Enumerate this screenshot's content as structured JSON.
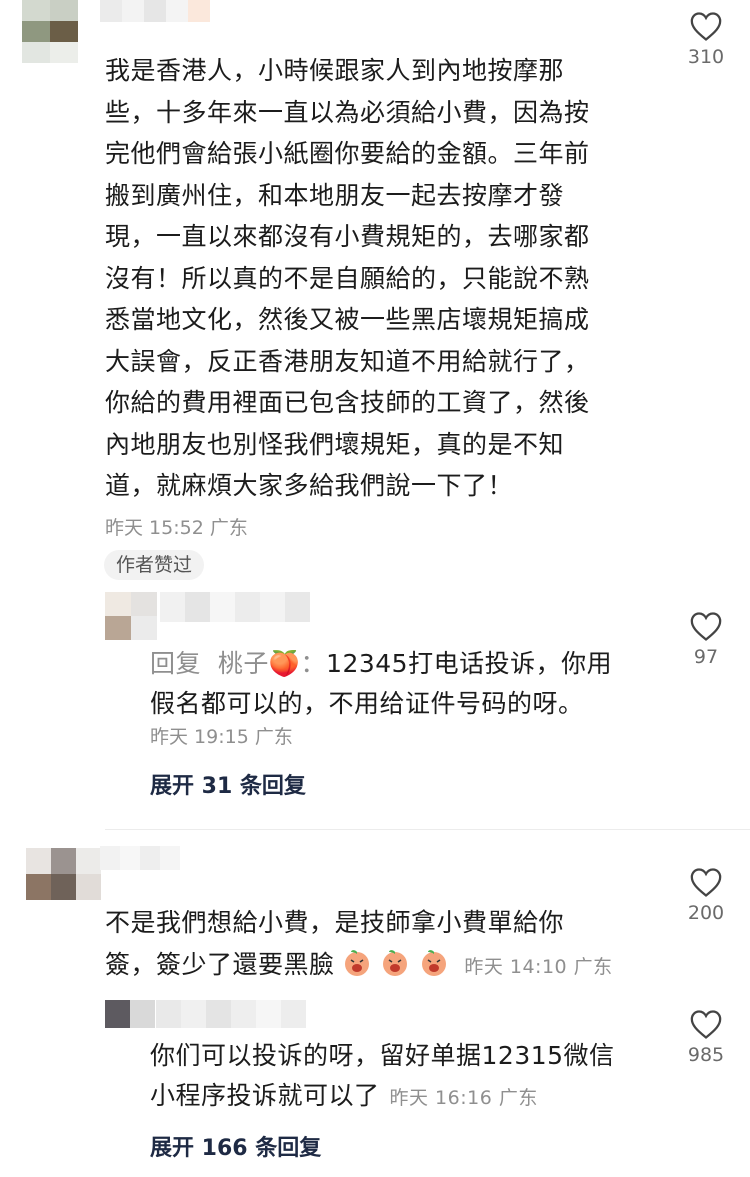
{
  "comments": [
    {
      "text": "我是香港人，小時候跟家人到內地按摩那些，十多年來一直以為必須給小費，因為按完他們會給張小紙圈你要給的金額。三年前搬到廣州住，和本地朋友一起去按摩才發現，一直以來都沒有小費規矩的，去哪家都沒有！所以真的不是自願給的，只能說不熟悉當地文化，然後又被一些黑店壞規矩搞成大誤會，反正香港朋友知道不用給就行了，你給的費用裡面已包含技師的工資了，然後內地朋友也別怪我們壞規矩，真的是不知道，就麻煩大家多給我們說一下了！",
      "lines": [
        "我是香港人，小時候跟家人到內地按摩那",
        "些，十多年來一直以為必須給小費，因為按",
        "完他們會給張小紙圈你要給的金額。三年前",
        "搬到廣州住，和本地朋友一起去按摩才發",
        "現，一直以來都沒有小費規矩的，去哪家都",
        "沒有！所以真的不是自願給的，只能說不熟",
        "悉當地文化，然後又被一些黑店壞規矩搞成",
        "大誤會，反正香港朋友知道不用給就行了，",
        "你給的費用裡面已包含技師的工資了，然後",
        "內地朋友也別怪我們壞規矩，真的是不知",
        "道，就麻煩大家多給我們說一下了！"
      ],
      "meta": "昨天 15:52 广东",
      "likes": "310",
      "badge": "作者赞过",
      "reply": {
        "prefix": "回复",
        "mention": "桃子🍑：",
        "line1": "12345打电话投诉，你用",
        "line2": "假名都可以的，不用给证件号码的呀。",
        "meta": "昨天 19:15 广东",
        "likes": "97"
      },
      "expand": "展开 31 条回复"
    },
    {
      "line1": "不是我們想給小費，是技師拿小費單給你",
      "line2": "簽，簽少了還要黑臉",
      "emoji_name": "laughing-peach-emoji",
      "meta": "昨天 14:10 广东",
      "likes": "200",
      "reply": {
        "line1": "你们可以投诉的呀，留好单据12315微信",
        "line2": "小程序投诉就可以了",
        "meta": "昨天 16:16 广东",
        "likes": "985"
      },
      "expand": "展开 166 条回复"
    }
  ],
  "colors": {
    "accent_dark": "#1e2a44",
    "meta_gray": "#8f8f8f"
  },
  "icons": {
    "like": "heart-outline-icon"
  }
}
